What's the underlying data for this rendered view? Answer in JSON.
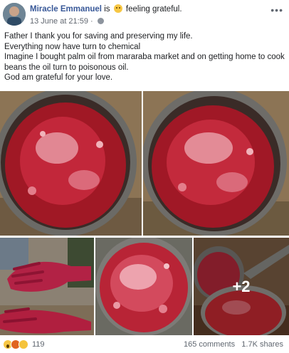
{
  "header": {
    "author": "Miracle Emmanuel",
    "is_word": "is",
    "feeling": "feeling grateful.",
    "timestamp": "13 June at 21:59",
    "separator": "·"
  },
  "post": {
    "lines": [
      "Father I thank you for saving and preserving my life.",
      "Everything now have turn to chemical",
      "Imagine I bought palm oil from mararaba market and on getting home to cook beans the oil turn to poisonous oil.",
      "God am grateful for your love."
    ]
  },
  "photos": {
    "more_count": "+2"
  },
  "footer": {
    "reaction_count": "119",
    "comments": "165 comments",
    "shares": "1.7K shares"
  },
  "icons": {
    "more": "more-options-icon",
    "globe": "globe-icon",
    "reactions": [
      "wow-icon",
      "angry-icon",
      "sad-icon"
    ]
  }
}
